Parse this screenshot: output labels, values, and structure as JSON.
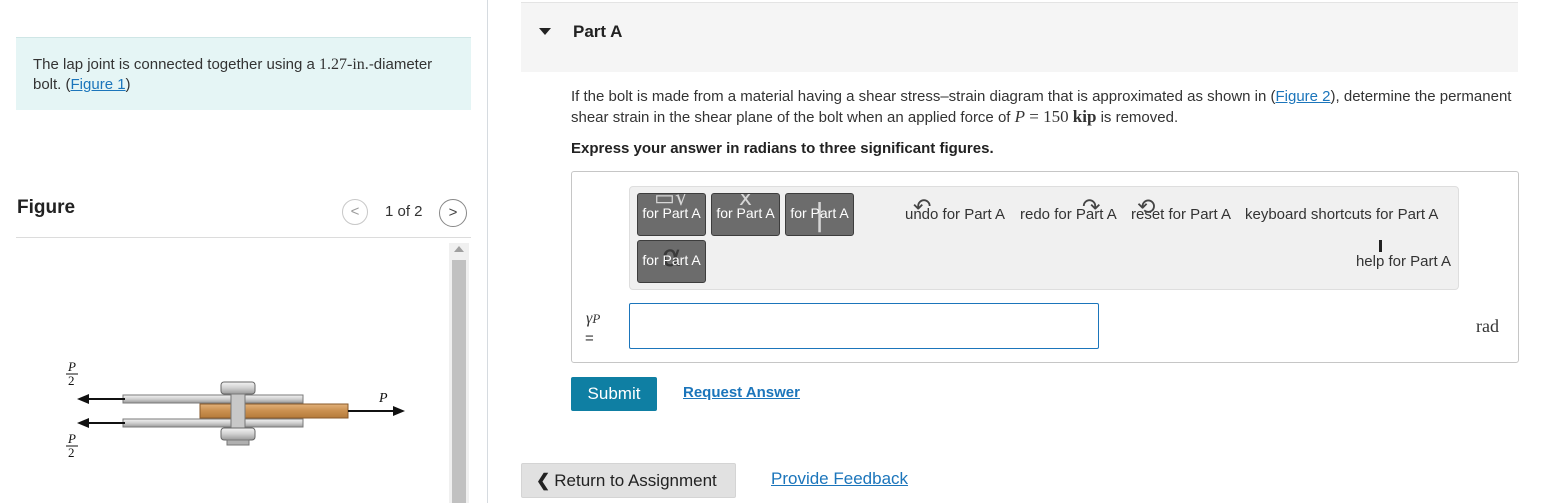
{
  "left": {
    "intro": {
      "text_before": "The lap joint is connected together using a ",
      "size_value": "1.27",
      "size_unit": "-in.",
      "text_mid": "-diameter bolt. (",
      "figure_link": "Figure 1",
      "text_after": ")"
    },
    "figure": {
      "label": "Figure",
      "prev_icon": "chevron-left-icon",
      "next_icon": "chevron-right-icon",
      "prev_glyph": "<",
      "next_glyph": ">",
      "counter": "1 of 2",
      "labels": {
        "p_half_num": "P",
        "p_half_den": "2",
        "p": "P"
      }
    }
  },
  "part": {
    "title": "Part A",
    "toggle_icon": "caret-down-icon",
    "question": {
      "text1": "If the bolt is made from a material having a shear stress–strain diagram that is approximated as shown in (",
      "figure_link": "Figure 2",
      "text2": "), determine the permanent shear strain in the shear plane of the bolt when an applied force of ",
      "force_var": "P",
      "equals": " = ",
      "force_value": "150",
      "force_unit": "kip",
      "text3": " is removed."
    },
    "instruction": "Express your answer in radians to three significant figures.",
    "toolbar": {
      "buttons": [
        {
          "label": "for Part A",
          "icon": "templates-icon"
        },
        {
          "label": "for Part A",
          "icon": "vector-icon"
        },
        {
          "label": "for Part A",
          "icon": "cursor-icon"
        },
        {
          "label": "for Part A",
          "icon": "greek-letters-icon"
        }
      ],
      "undo": "undo for Part A",
      "redo": "redo for Part A",
      "reset": "reset for Part A",
      "keyboard": "keyboard shortcuts for Part A",
      "help": "help for Part A"
    },
    "answer": {
      "variable": "γ",
      "subscript": "P",
      "equals": "=",
      "value": "",
      "placeholder": "",
      "unit": "rad"
    },
    "submit_label": "Submit",
    "request_answer_label": "Request Answer"
  },
  "footer": {
    "return_label": "Return to Assignment",
    "return_icon": "chevron-left-icon",
    "feedback_label": "Provide Feedback"
  },
  "colors": {
    "intro_bg": "#e5f5f5",
    "link": "#1b75bb",
    "submit_bg": "#0f7fa3",
    "toolbar_button": "#6c6c6c",
    "input_border": "#1b75bb"
  }
}
